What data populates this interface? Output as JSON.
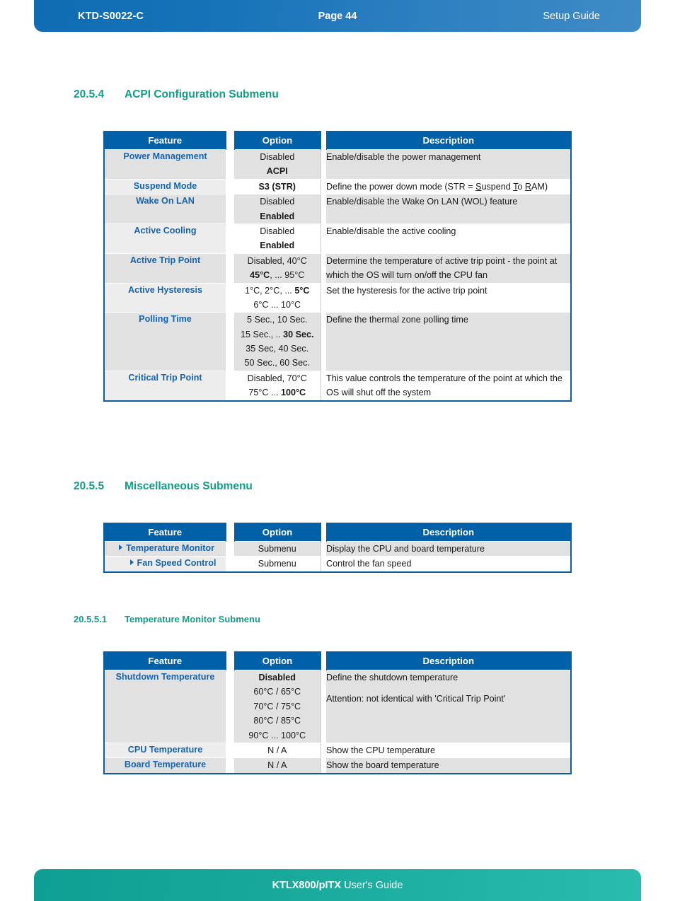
{
  "header": {
    "doc_id": "KTD-S0022-C",
    "page_label": "Page 44",
    "guide_label": "Setup Guide"
  },
  "footer": {
    "product": "KTLX800/pITX",
    "suffix": "User's Guide"
  },
  "table_headers": {
    "feature": "Feature",
    "option": "Option",
    "description": "Description"
  },
  "sections": [
    {
      "number": "20.5.4",
      "title": "ACPI Configuration Submenu",
      "rows": [
        {
          "feature": "Power Management",
          "options": [
            {
              "text": "Disabled",
              "bold": false
            },
            {
              "text": "ACPI",
              "bold": true
            }
          ],
          "description": [
            "Enable/disable the power management"
          ]
        },
        {
          "feature": "Suspend Mode",
          "options": [
            {
              "text": "S3 (STR)",
              "bold": true
            }
          ],
          "description": [
            "Define the power down mode (STR = Suspend To RAM)"
          ],
          "description_html": "Define the power down mode (STR = <u class=\"acc\">S</u>uspend <u class=\"acc\">T</u>o <u class=\"acc\">R</u>AM)"
        },
        {
          "feature": "Wake On LAN",
          "options": [
            {
              "text": "Disabled",
              "bold": false
            },
            {
              "text": "Enabled",
              "bold": true
            }
          ],
          "description": [
            "Enable/disable the Wake On LAN (WOL) feature"
          ]
        },
        {
          "feature": "Active Cooling",
          "options": [
            {
              "text": "Disabled",
              "bold": false
            },
            {
              "text": "Enabled",
              "bold": true
            }
          ],
          "description": [
            "Enable/disable the active cooling"
          ]
        },
        {
          "feature": "Active Trip Point",
          "options": [
            {
              "text": "Disabled, 40°C",
              "bold": false
            },
            {
              "text": "45°C, ... 95°C",
              "bold": false,
              "html": "<b class=\"inline-b\">45°C</b>, ... 95°C"
            }
          ],
          "description": [
            "Determine the temperature of active trip point - the point at which the OS will turn on/off the CPU fan"
          ]
        },
        {
          "feature": "Active Hysteresis",
          "options": [
            {
              "text": "1°C, 2°C, ... 5°C",
              "bold": false,
              "html": "1°C, 2°C, ... <b class=\"inline-b\">5°C</b>"
            },
            {
              "text": "6°C ... 10°C",
              "bold": false
            }
          ],
          "description": [
            "Set the hysteresis for the active trip point"
          ]
        },
        {
          "feature": "Polling Time",
          "options": [
            {
              "text": "5 Sec., 10 Sec.",
              "bold": false
            },
            {
              "text": "15 Sec., .. 30 Sec.",
              "bold": false,
              "html": "15 Sec., .. <b class=\"inline-b\">30 Sec.</b>"
            },
            {
              "text": "35 Sec, 40 Sec.",
              "bold": false
            },
            {
              "text": "50 Sec., 60 Sec.",
              "bold": false
            }
          ],
          "description": [
            "Define the thermal zone polling time"
          ]
        },
        {
          "feature": "Critical Trip Point",
          "options": [
            {
              "text": "Disabled, 70°C",
              "bold": false
            },
            {
              "text": "75°C ... 100°C",
              "bold": false,
              "html": "75°C ... <b class=\"inline-b\">100°C</b>"
            }
          ],
          "description": [
            "This value controls the temperature of the point at which the OS will shut off the system"
          ]
        }
      ]
    },
    {
      "number": "20.5.5",
      "title": "Miscellaneous Submenu",
      "rows": [
        {
          "feature": "Temperature Monitor",
          "marker": "triangle",
          "indent": 1,
          "options": [
            {
              "text": "Submenu",
              "bold": false
            }
          ],
          "description": [
            "Display the CPU and board temperature"
          ]
        },
        {
          "feature": "Fan Speed Control",
          "marker": "triangle",
          "indent": 2,
          "options": [
            {
              "text": "Submenu",
              "bold": false
            }
          ],
          "description": [
            "Control the fan speed"
          ]
        }
      ]
    },
    {
      "number": "20.5.5.1",
      "title": "Temperature Monitor Submenu",
      "level": 4,
      "rows": [
        {
          "feature": "Shutdown Temperature",
          "options": [
            {
              "text": "Disabled",
              "bold": true
            },
            {
              "text": "60°C / 65°C",
              "bold": false
            },
            {
              "text": "70°C / 75°C",
              "bold": false
            },
            {
              "text": "80°C / 85°C",
              "bold": false
            },
            {
              "text": "90°C ... 100°C",
              "bold": false
            }
          ],
          "description": [
            "Define the shutdown temperature",
            "Attention: not identical with 'Critical Trip Point'"
          ]
        },
        {
          "feature": "CPU Temperature",
          "options": [
            {
              "text": "N / A",
              "bold": false
            }
          ],
          "description": [
            "Show the CPU temperature"
          ]
        },
        {
          "feature": "Board Temperature",
          "options": [
            {
              "text": "N / A",
              "bold": false
            }
          ],
          "description": [
            "Show the board temperature"
          ]
        }
      ]
    }
  ],
  "colors": {
    "header_blue": "#1673b8",
    "footer_teal": "#17a79a",
    "heading_teal": "#119e87",
    "table_header_blue": "#0061a8",
    "feature_blue": "#1565b0",
    "row_gray": "#e1e1e1"
  }
}
